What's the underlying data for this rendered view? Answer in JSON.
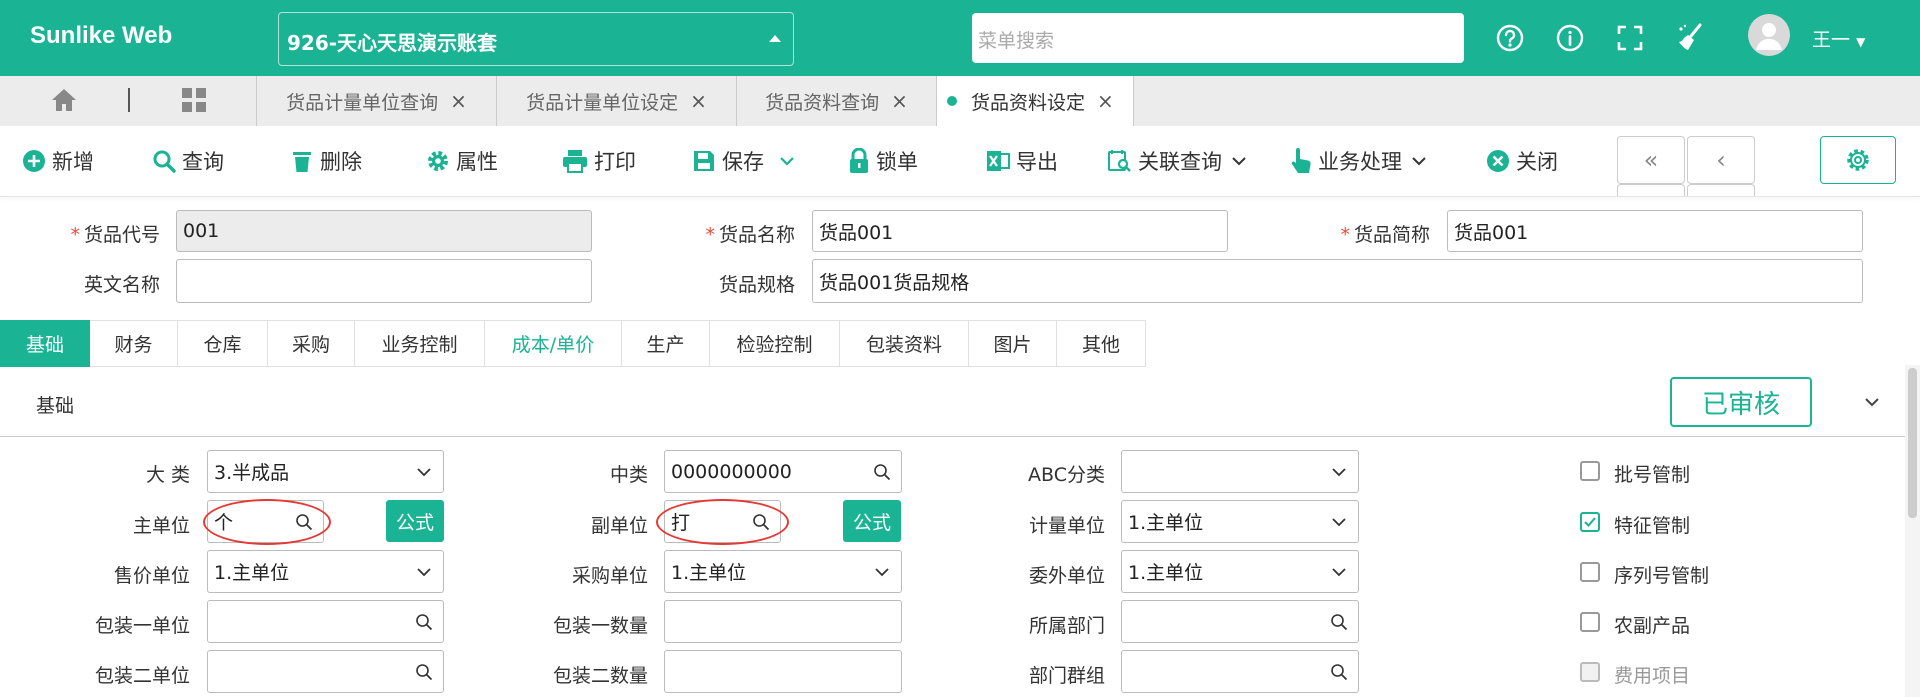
{
  "header": {
    "brand": "Sunlike Web",
    "account": "926-天心天思演示账套",
    "search_placeholder": "菜单搜索",
    "user": "王一"
  },
  "tabs": [
    {
      "label": "货品计量单位查询",
      "active": false
    },
    {
      "label": "货品计量单位设定",
      "active": false
    },
    {
      "label": "货品资料查询",
      "active": false
    },
    {
      "label": "货品资料设定",
      "active": true
    }
  ],
  "toolbar": {
    "new": "新增",
    "query": "查询",
    "delete": "删除",
    "props": "属性",
    "print": "打印",
    "save": "保存",
    "lock": "锁单",
    "export": "导出",
    "related": "关联查询",
    "business": "业务处理",
    "close": "关闭"
  },
  "top_form": {
    "code_label": "货品代号",
    "code_value": "001",
    "name_label": "货品名称",
    "name_value": "货品001",
    "short_label": "货品简称",
    "short_value": "货品001",
    "en_label": "英文名称",
    "en_value": "",
    "spec_label": "货品规格",
    "spec_value": "货品001货品规格"
  },
  "subtabs": [
    "基础",
    "财务",
    "仓库",
    "采购",
    "业务控制",
    "成本/单价",
    "生产",
    "检验控制",
    "包装资料",
    "图片",
    "其他"
  ],
  "panel": {
    "title": "基础",
    "status": "已审核"
  },
  "fields": {
    "category_label": "大 类",
    "category_value": "3.半成品",
    "mid_label": "中类",
    "mid_value": "0000000000",
    "abc_label": "ABC分类",
    "abc_value": "",
    "main_unit_label": "主单位",
    "main_unit_value": "个",
    "formula": "公式",
    "sub_unit_label": "副单位",
    "sub_unit_value": "打",
    "measure_label": "计量单位",
    "measure_value": "1.主单位",
    "sale_unit_label": "售价单位",
    "sale_unit_value": "1.主单位",
    "purchase_unit_label": "采购单位",
    "purchase_unit_value": "1.主单位",
    "outsource_label": "委外单位",
    "outsource_value": "1.主单位",
    "pack1_unit_label": "包装一单位",
    "pack1_qty_label": "包装一数量",
    "dept_label": "所属部门",
    "pack2_unit_label": "包装二单位",
    "pack2_qty_label": "包装二数量",
    "dept_group_label": "部门群组"
  },
  "checkboxes": [
    {
      "label": "批号管制",
      "checked": false,
      "disabled": false
    },
    {
      "label": "特征管制",
      "checked": true,
      "disabled": false
    },
    {
      "label": "序列号管制",
      "checked": false,
      "disabled": false
    },
    {
      "label": "农副产品",
      "checked": false,
      "disabled": false
    },
    {
      "label": "费用项目",
      "checked": false,
      "disabled": true
    }
  ],
  "colors": {
    "accent": "#1ab394",
    "required": "#e74c3c",
    "annotation": "#e53935"
  }
}
